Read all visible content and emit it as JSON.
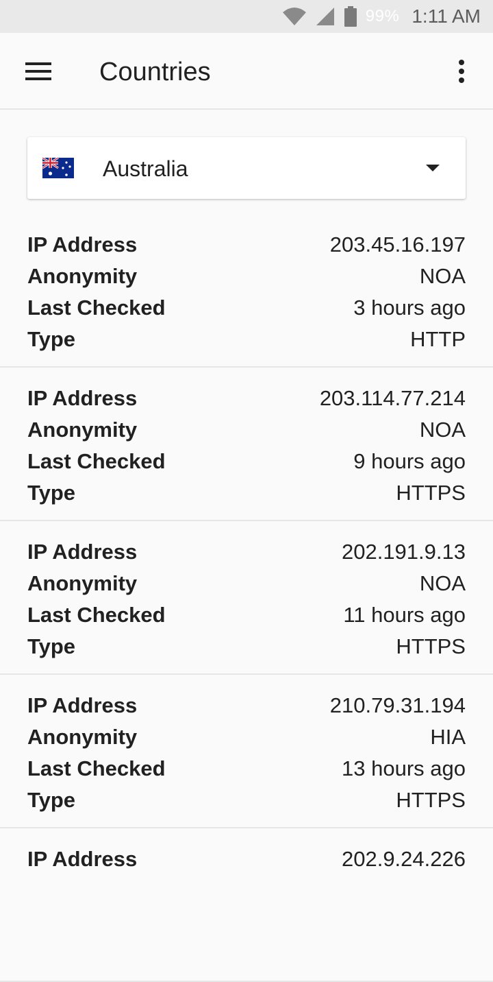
{
  "status_bar": {
    "battery": "99%",
    "time": "1:11 AM"
  },
  "app_bar": {
    "title": "Countries"
  },
  "country_selector": {
    "selected": "Australia",
    "flag_icon": "australia-flag-icon"
  },
  "labels": {
    "ip": "IP Address",
    "anonymity": "Anonymity",
    "last_checked": "Last Checked",
    "type": "Type"
  },
  "proxies": [
    {
      "ip": "203.45.16.197",
      "anonymity": "NOA",
      "last_checked": "3 hours ago",
      "type": "HTTP"
    },
    {
      "ip": "203.114.77.214",
      "anonymity": "NOA",
      "last_checked": "9 hours ago",
      "type": "HTTPS"
    },
    {
      "ip": "202.191.9.13",
      "anonymity": "NOA",
      "last_checked": "11 hours ago",
      "type": "HTTPS"
    },
    {
      "ip": "210.79.31.194",
      "anonymity": "HIA",
      "last_checked": "13 hours ago",
      "type": "HTTPS"
    },
    {
      "ip": "202.9.24.226",
      "anonymity": "",
      "last_checked": "",
      "type": ""
    }
  ]
}
